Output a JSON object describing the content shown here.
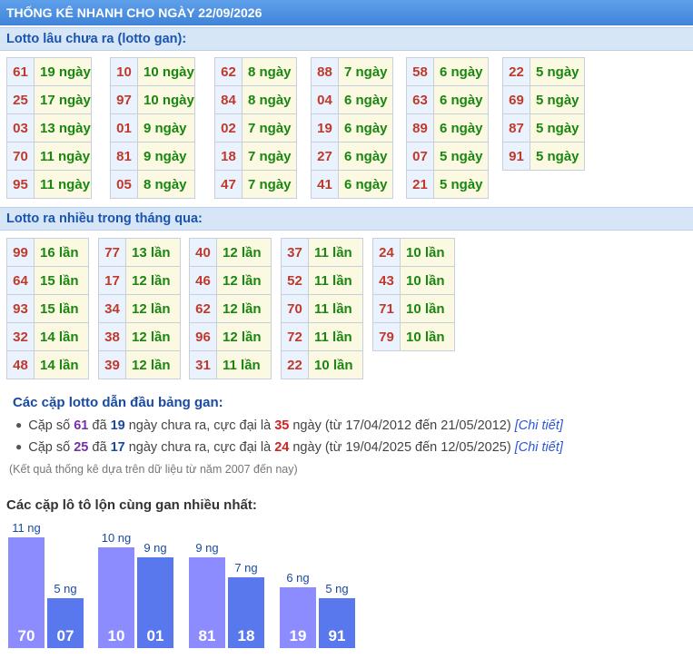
{
  "header": {
    "title": "THỐNG KÊ NHANH CHO NGÀY 22/09/2026"
  },
  "gan": {
    "title": "Lotto lâu chưa ra (lotto gan):",
    "groups": [
      [
        [
          "61",
          "19 ngày"
        ],
        [
          "25",
          "17 ngày"
        ],
        [
          "03",
          "13 ngày"
        ],
        [
          "70",
          "11 ngày"
        ],
        [
          "95",
          "11 ngày"
        ]
      ],
      [
        [
          "10",
          "10 ngày"
        ],
        [
          "97",
          "10 ngày"
        ],
        [
          "01",
          "9 ngày"
        ],
        [
          "81",
          "9 ngày"
        ],
        [
          "05",
          "8 ngày"
        ]
      ],
      [
        [
          "62",
          "8 ngày"
        ],
        [
          "84",
          "8 ngày"
        ],
        [
          "02",
          "7 ngày"
        ],
        [
          "18",
          "7 ngày"
        ],
        [
          "47",
          "7 ngày"
        ]
      ],
      [
        [
          "88",
          "7 ngày"
        ],
        [
          "04",
          "6 ngày"
        ],
        [
          "19",
          "6 ngày"
        ],
        [
          "27",
          "6 ngày"
        ],
        [
          "41",
          "6 ngày"
        ]
      ],
      [
        [
          "58",
          "6 ngày"
        ],
        [
          "63",
          "6 ngày"
        ],
        [
          "89",
          "6 ngày"
        ],
        [
          "07",
          "5 ngày"
        ],
        [
          "21",
          "5 ngày"
        ]
      ],
      [
        [
          "22",
          "5 ngày"
        ],
        [
          "69",
          "5 ngày"
        ],
        [
          "87",
          "5 ngày"
        ],
        [
          "91",
          "5 ngày"
        ]
      ]
    ]
  },
  "nhieu": {
    "title": "Lotto ra nhiều trong tháng qua:",
    "groups": [
      [
        [
          "99",
          "16 lần"
        ],
        [
          "64",
          "15 lần"
        ],
        [
          "93",
          "15 lần"
        ],
        [
          "32",
          "14 lần"
        ],
        [
          "48",
          "14 lần"
        ]
      ],
      [
        [
          "77",
          "13 lần"
        ],
        [
          "17",
          "12 lần"
        ],
        [
          "34",
          "12 lần"
        ],
        [
          "38",
          "12 lần"
        ],
        [
          "39",
          "12 lần"
        ]
      ],
      [
        [
          "40",
          "12 lần"
        ],
        [
          "46",
          "12 lần"
        ],
        [
          "62",
          "12 lần"
        ],
        [
          "96",
          "12 lần"
        ],
        [
          "31",
          "11 lần"
        ]
      ],
      [
        [
          "37",
          "11 lần"
        ],
        [
          "52",
          "11 lần"
        ],
        [
          "70",
          "11 lần"
        ],
        [
          "72",
          "11 lần"
        ],
        [
          "22",
          "10 lần"
        ]
      ],
      [
        [
          "24",
          "10 lần"
        ],
        [
          "43",
          "10 lần"
        ],
        [
          "71",
          "10 lần"
        ],
        [
          "79",
          "10 lần"
        ]
      ]
    ]
  },
  "leaders": {
    "title": "Các cặp lotto dẫn đầu bảng gan:",
    "items": [
      {
        "t1": "Cặp số ",
        "pair": "61",
        "t2": " đã ",
        "days": "19",
        "t3": " ngày chưa ra, cực đại là ",
        "max": "35",
        "t4": " ngày (từ 17/04/2012 đến 21/05/2012) ",
        "link": "[Chi tiết]"
      },
      {
        "t1": "Cặp số ",
        "pair": "25",
        "t2": " đã ",
        "days": "17",
        "t3": " ngày chưa ra, cực đại là ",
        "max": "24",
        "t4": " ngày (từ 19/04/2025 đến 12/05/2025) ",
        "link": "[Chi tiết]"
      }
    ],
    "note": "(Kết quả thống kê dựa trên dữ liệu từ năm 2007 đến nay)"
  },
  "chart_title": "Các cặp lô tô lộn cùng gan nhiều nhất:",
  "chart_data": {
    "type": "bar",
    "ymax": 11,
    "colors": {
      "first": "#8c8cff",
      "second": "#5a78ee"
    },
    "pairs": [
      [
        {
          "num": "70",
          "value": 11,
          "label": "11 ng"
        },
        {
          "num": "07",
          "value": 5,
          "label": "5 ng"
        }
      ],
      [
        {
          "num": "10",
          "value": 10,
          "label": "10 ng"
        },
        {
          "num": "01",
          "value": 9,
          "label": "9 ng"
        }
      ],
      [
        {
          "num": "81",
          "value": 9,
          "label": "9 ng"
        },
        {
          "num": "18",
          "value": 7,
          "label": "7 ng"
        }
      ],
      [
        {
          "num": "19",
          "value": 6,
          "label": "6 ng"
        },
        {
          "num": "91",
          "value": 5,
          "label": "5 ng"
        }
      ]
    ]
  }
}
